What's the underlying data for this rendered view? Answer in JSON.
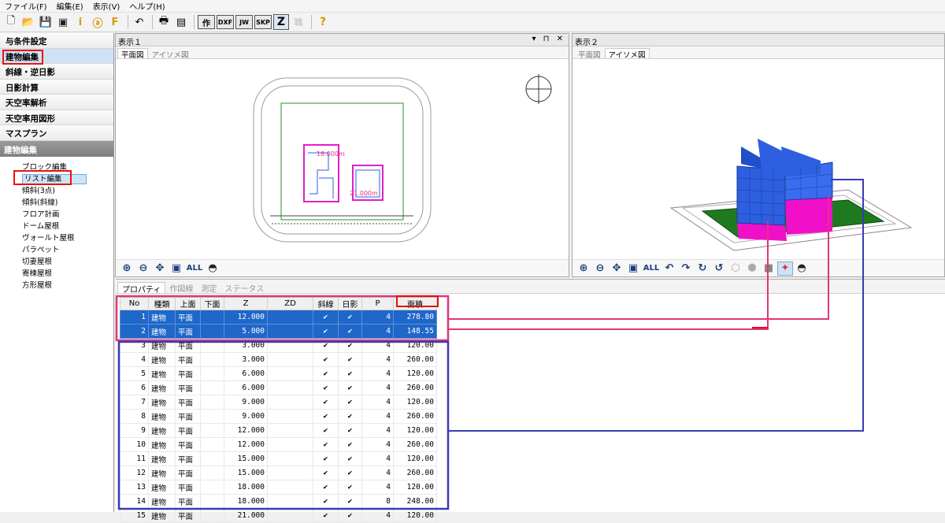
{
  "menu": [
    "ファイル(F)",
    "編集(E)",
    "表示(V)",
    "ヘルプ(H)"
  ],
  "toolbar": {
    "icons": [
      "new-icon",
      "open-icon",
      "save-icon",
      "save-as-icon",
      "info-icon",
      "at-icon",
      "f-icon",
      "undo-icon",
      "print-icon",
      "layout-icon"
    ],
    "mode_buttons": [
      "作",
      "DXF",
      "JW",
      "SKP",
      "Z",
      "職",
      "?"
    ]
  },
  "sidebar": {
    "categories": [
      "与条件設定",
      "建物編集",
      "斜線・逆日影",
      "日影計算",
      "天空率解析",
      "天空率用図形",
      "マスプラン"
    ],
    "section_header": "建物編集",
    "items": [
      "ブロック編集",
      "リスト編集",
      "傾斜(3点)",
      "傾斜(斜線)",
      "フロア計画",
      "ドーム屋根",
      "ヴォールト屋根",
      "パラペット",
      "切妻屋根",
      "寄棟屋根",
      "方形屋根"
    ]
  },
  "view1": {
    "title": "表示１",
    "tabs": [
      "平面図",
      "アイソメ図"
    ],
    "labels": [
      "18.000m",
      "21.000m"
    ],
    "tools_all": "ALL"
  },
  "view2": {
    "title": "表示２",
    "tabs": [
      "平面図",
      "アイソメ図"
    ],
    "tools_all": "ALL"
  },
  "props": {
    "tabs": [
      "プロパティ",
      "作図線",
      "測定",
      "ステータス"
    ],
    "columns": [
      "No",
      "種類",
      "上面",
      "下面",
      "Z",
      "ZD",
      "斜線",
      "日影",
      "P",
      "面積"
    ],
    "rows": [
      [
        "1",
        "建物",
        "平面",
        "",
        "12.000",
        "",
        "✔",
        "✔",
        "4",
        "278.80"
      ],
      [
        "2",
        "建物",
        "平面",
        "",
        "5.000",
        "",
        "✔",
        "✔",
        "4",
        "148.55"
      ],
      [
        "3",
        "建物",
        "平面",
        "",
        "3.000",
        "",
        "✔",
        "✔",
        "4",
        "120.00"
      ],
      [
        "4",
        "建物",
        "平面",
        "",
        "3.000",
        "",
        "✔",
        "✔",
        "4",
        "260.00"
      ],
      [
        "5",
        "建物",
        "平面",
        "",
        "6.000",
        "",
        "✔",
        "✔",
        "4",
        "120.00"
      ],
      [
        "6",
        "建物",
        "平面",
        "",
        "6.000",
        "",
        "✔",
        "✔",
        "4",
        "260.00"
      ],
      [
        "7",
        "建物",
        "平面",
        "",
        "9.000",
        "",
        "✔",
        "✔",
        "4",
        "120.00"
      ],
      [
        "8",
        "建物",
        "平面",
        "",
        "9.000",
        "",
        "✔",
        "✔",
        "4",
        "260.00"
      ],
      [
        "9",
        "建物",
        "平面",
        "",
        "12.000",
        "",
        "✔",
        "✔",
        "4",
        "120.00"
      ],
      [
        "10",
        "建物",
        "平面",
        "",
        "12.000",
        "",
        "✔",
        "✔",
        "4",
        "260.00"
      ],
      [
        "11",
        "建物",
        "平面",
        "",
        "15.000",
        "",
        "✔",
        "✔",
        "4",
        "120.00"
      ],
      [
        "12",
        "建物",
        "平面",
        "",
        "15.000",
        "",
        "✔",
        "✔",
        "4",
        "260.00"
      ],
      [
        "13",
        "建物",
        "平面",
        "",
        "18.000",
        "",
        "✔",
        "✔",
        "4",
        "120.00"
      ],
      [
        "14",
        "建物",
        "平面",
        "",
        "18.000",
        "",
        "✔",
        "✔",
        "8",
        "248.00"
      ],
      [
        "15",
        "建物",
        "平面",
        "",
        "21.000",
        "",
        "✔",
        "✔",
        "4",
        "120.00"
      ]
    ],
    "selected_rows": [
      0,
      1
    ]
  },
  "colors": {
    "accent_red": "#e11111",
    "highlight_pink": "#e0357a",
    "highlight_blue": "#3a3ab5",
    "selection": "#1f67c9",
    "building_blue": "#2d5fe0",
    "building_magenta": "#f010c8",
    "ground_green": "#1f7a1f"
  }
}
